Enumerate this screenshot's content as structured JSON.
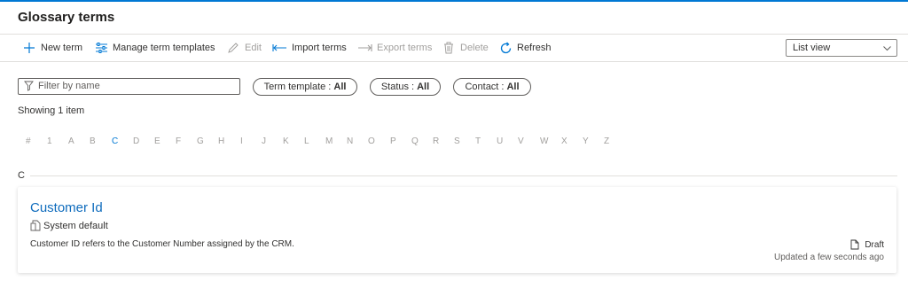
{
  "header": {
    "title": "Glossary terms"
  },
  "toolbar": {
    "new_term": "New term",
    "manage_templates": "Manage term templates",
    "edit": "Edit",
    "import_terms": "Import terms",
    "export_terms": "Export terms",
    "delete": "Delete",
    "refresh": "Refresh"
  },
  "view_select": {
    "value": "List view"
  },
  "filter": {
    "placeholder": "Filter by name"
  },
  "pills": {
    "term_template": {
      "label": "Term template :",
      "value": "All"
    },
    "status": {
      "label": "Status :",
      "value": "All"
    },
    "contact": {
      "label": "Contact :",
      "value": "All"
    }
  },
  "showing": "Showing 1 item",
  "alphabet": [
    "#",
    "1",
    "A",
    "B",
    "C",
    "D",
    "E",
    "F",
    "G",
    "H",
    "I",
    "J",
    "K",
    "L",
    "M",
    "N",
    "O",
    "P",
    "Q",
    "R",
    "S",
    "T",
    "U",
    "V",
    "W",
    "X",
    "Y",
    "Z"
  ],
  "alphabet_active": "C",
  "section": {
    "letter": "C"
  },
  "term": {
    "name": "Customer Id",
    "source": "System default",
    "description": "Customer ID refers to the Customer Number assigned by the CRM.",
    "status": "Draft",
    "updated": "Updated a few seconds ago"
  },
  "colors": {
    "accent": "#0078d4",
    "link": "#0f6cbd",
    "disabled": "#a19f9d",
    "border": "#e1dfdd"
  },
  "icons": {
    "new_term": "plus-icon",
    "manage_templates": "sliders-icon",
    "edit": "pencil-icon",
    "import_terms": "import-arrow-icon",
    "export_terms": "export-arrow-icon",
    "delete": "trash-icon",
    "refresh": "refresh-icon",
    "view_select": "chevron-down-icon",
    "filter": "funnel-icon",
    "source": "document-icon",
    "status": "document-icon"
  }
}
